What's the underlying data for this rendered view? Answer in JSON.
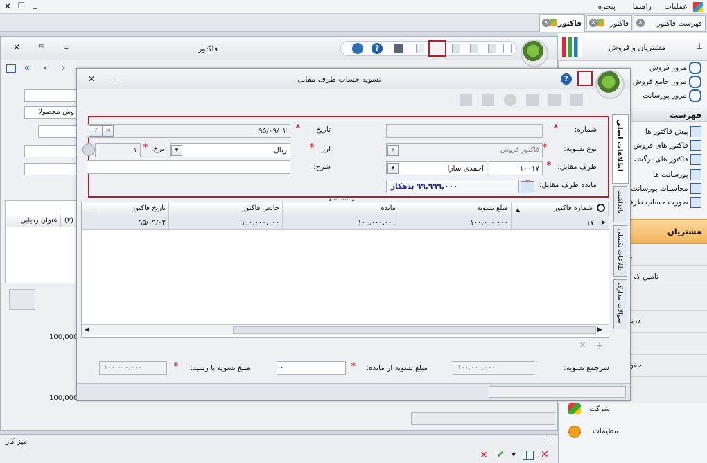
{
  "menubar": {
    "items": [
      "عملیات",
      "راهنما",
      "پنجره"
    ]
  },
  "tabs": [
    {
      "label": "فهرست فاکتور"
    },
    {
      "label": "فاکتور"
    },
    {
      "label": "فاکتور"
    }
  ],
  "bg_window": {
    "title": "فاکتور",
    "col_tracking": "عنوان ردیابی",
    "col_num2": "(۲)",
    "values": [
      "100,000",
      "100,000"
    ],
    "field_products": "وش محصولا"
  },
  "side_panel": {
    "title": "مشتریان و فروش",
    "review_items": [
      "مرور فروش",
      "مرور جامع فروش",
      "مرور پورسانت"
    ],
    "list_header": "فهرست",
    "list_items": [
      "پیش فاکتور ها",
      "فاکتور های فروش",
      "فاکتور های برگشت",
      "پورسانت ها",
      "محاسبات پورسانت",
      "صورت حساب طرف"
    ],
    "section_customers": "مشتریان",
    "partial_items": [
      "خ",
      "تامین ک",
      "دریا",
      "حقو"
    ],
    "bottom_items": [
      "شرکت",
      "تنظیمات"
    ]
  },
  "dialog": {
    "title": "تسویه حساب طرف مقابل",
    "vtabs": [
      "اطلاعات اصلی",
      "یادداشت",
      "اطلاعات تکمیلی",
      "سوالات مدارک"
    ],
    "form": {
      "number_label": "شماره:",
      "number_value": "",
      "date_label": "تاریخ:",
      "date_value": "۹۵/۰۹/۰۲",
      "settlement_type_label": "نوع تسویه:",
      "settlement_type_value": "فاکتور فروش",
      "currency_label": "ارز",
      "currency_value": "ریال",
      "rate_label": "نرخ:",
      "rate_value": "۱",
      "party_label": "طرف مقابل:",
      "party_code": "۱۰۰۱۷",
      "party_name": "احمدی سارا",
      "desc_label": "شرح:",
      "desc_value": "",
      "balance_label": "مانده طرف مقابل:",
      "balance_value": "۹۹,۹۹۹,۰۰۰ بدهکار"
    },
    "grid": {
      "columns": [
        "شماره فاکتور",
        "مبلغ تسویه",
        "مانده",
        "خالص فاکتور",
        "تاریخ فاکتور"
      ],
      "rows": [
        {
          "invoice_no": "۱۷",
          "settle_amount": "۱۰۰,۰۰۰,۰۰۰",
          "remaining": "۱۰۰,۰۰۰,۰۰۰",
          "net": "۱۰۰,۰۰۰,۰۰۰",
          "date": "۹۵/۰۹/۰۲"
        }
      ]
    },
    "footer": {
      "total_label": "سرجمع تسویه:",
      "total_value": "۱۰۰,۰۰۰,۰۰۰",
      "from_balance_label": "مبلغ تسویه از مانده:",
      "from_balance_value": "۰",
      "receipt_label": "مبلغ تسویه با رسید:",
      "receipt_value": "۱۰۰,۰۰۰,۰۰۰"
    }
  },
  "desk": {
    "title": "میز کار"
  },
  "colors": {
    "accent_red": "#b0202a",
    "side_orange": "#f6c77a"
  }
}
